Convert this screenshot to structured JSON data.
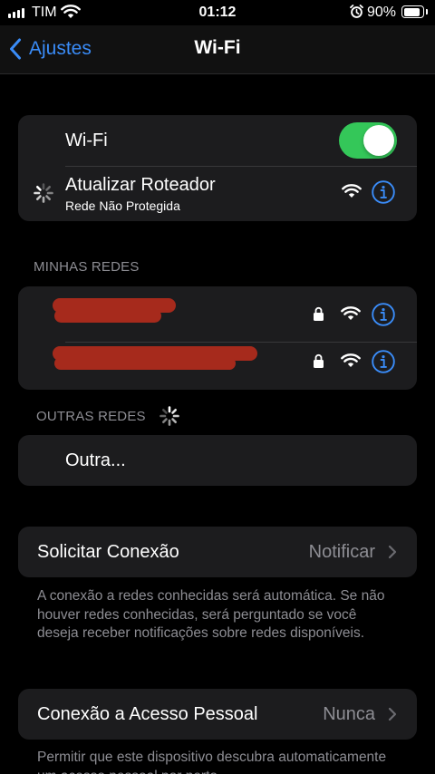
{
  "status_bar": {
    "carrier": "TIM",
    "time": "01:12",
    "battery_percent": "90%",
    "battery_level": 0.9,
    "icons": [
      "cellular-signal-icon",
      "wifi-icon",
      "alarm-icon",
      "battery-icon"
    ]
  },
  "nav": {
    "back_label": "Ajustes",
    "title": "Wi-Fi"
  },
  "wifi_group": {
    "toggle_label": "Wi-Fi",
    "toggle_on": true,
    "current_network": {
      "name": "Atualizar Roteador",
      "subtitle": "Rede Não Protegida",
      "status": "connecting"
    }
  },
  "my_networks": {
    "header": "MINHAS REDES",
    "networks": [
      {
        "name_redacted": true,
        "secured": true
      },
      {
        "name_redacted": true,
        "secured": true
      }
    ]
  },
  "other_networks": {
    "header": "OUTRAS REDES",
    "other_label": "Outra..."
  },
  "ask_to_join": {
    "label": "Solicitar Conexão",
    "value": "Notificar",
    "footer": "A conexão a redes conhecidas será automática. Se não houver redes conhecidas, será perguntado se você deseja receber notificações sobre redes disponíveis."
  },
  "hotspot": {
    "label": "Conexão a Acesso Pessoal",
    "value": "Nunca",
    "footer": "Permitir que este dispositivo descubra automaticamente um acesso pessoal por perto"
  },
  "colors": {
    "accent": "#3a8cf8",
    "toggle_on": "#34c759",
    "cell_bg": "#1c1c1e",
    "secondary_text": "#8d8d93",
    "redaction": "#a62a1c"
  }
}
